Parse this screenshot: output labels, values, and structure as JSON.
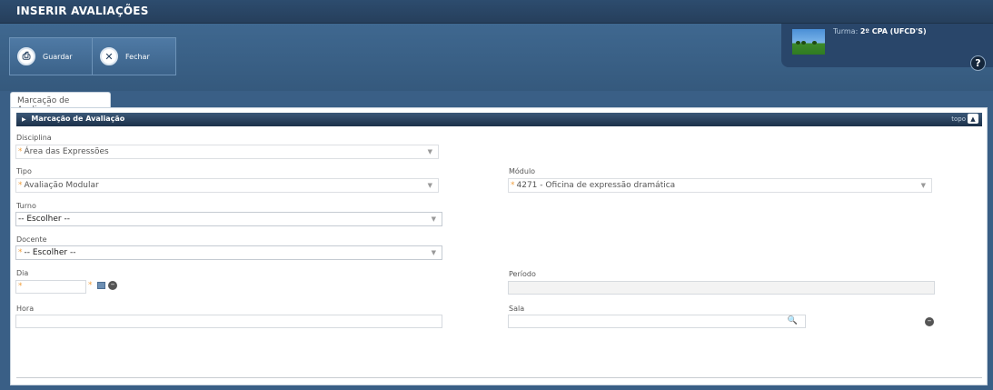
{
  "header": {
    "title": "INSERIR AVALIAÇÕES"
  },
  "toolbar": {
    "save_label": "Guardar",
    "close_label": "Fechar"
  },
  "turma": {
    "label": "Turma:",
    "value": "2º CPA (UFCD'S)"
  },
  "help": {
    "label": "?"
  },
  "tab": {
    "label": "Marcação de Avaliação"
  },
  "section": {
    "title": "Marcação de Avaliação",
    "topo_label": "topo"
  },
  "form": {
    "required_mark": "*",
    "disciplina": {
      "label": "Disciplina",
      "value": "Área das Expressões"
    },
    "tipo": {
      "label": "Tipo",
      "value": "Avaliação Modular"
    },
    "modulo": {
      "label": "Módulo",
      "value": "4271 - Oficina de expressão dramática"
    },
    "turno": {
      "label": "Turno",
      "value": "-- Escolher --"
    },
    "docente": {
      "label": "Docente",
      "value": "-- Escolher --"
    },
    "dia": {
      "label": "Dia",
      "value": ""
    },
    "periodo": {
      "label": "Período",
      "value": ""
    },
    "hora": {
      "label": "Hora",
      "value": ""
    },
    "sala": {
      "label": "Sala",
      "value": ""
    }
  },
  "icons": {
    "save": "print-icon",
    "close": "close-icon",
    "calendar": "calendar-icon",
    "clear": "minus-circle-icon",
    "search": "magnifier-icon"
  },
  "colors": {
    "background": "#3a5f86",
    "header": "#263f5c",
    "required": "#f0a040"
  }
}
